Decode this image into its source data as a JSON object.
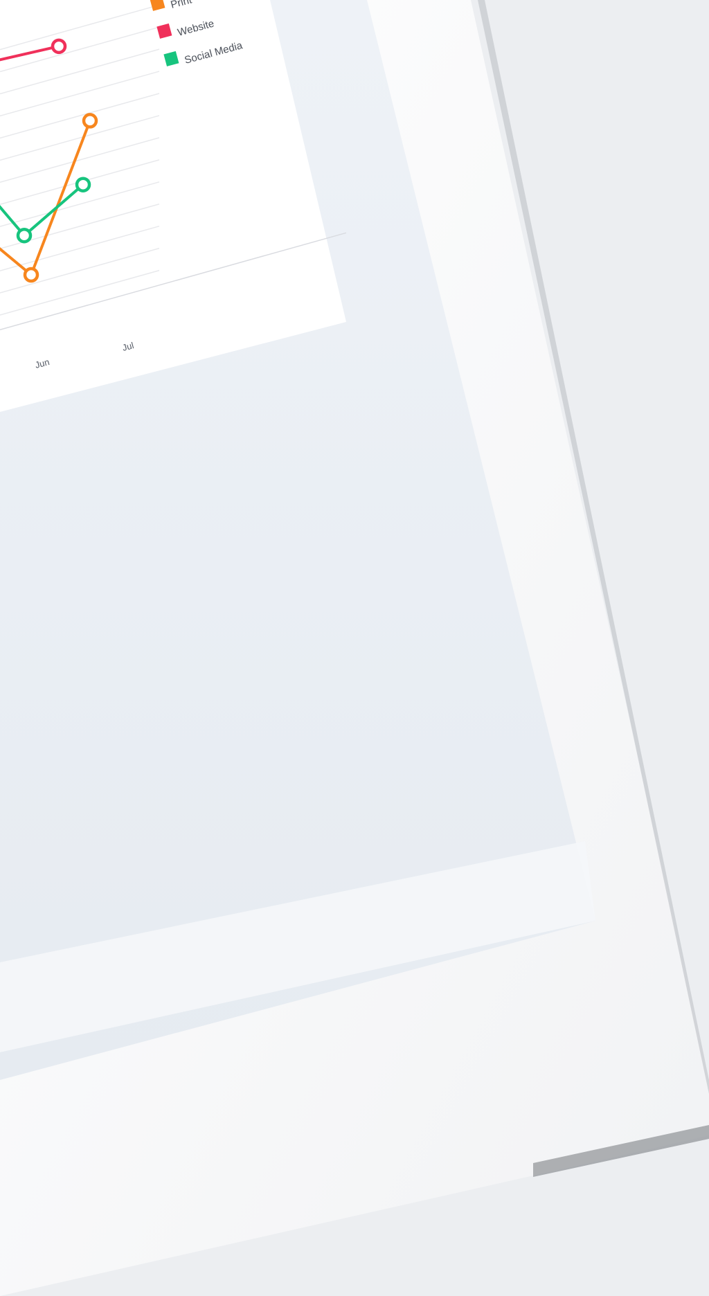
{
  "colors": {
    "print": "#f7861e",
    "website": "#f0305a",
    "social_media": "#17c47e",
    "screen_bg": "#e9edf3",
    "panel_bg": "#ffffff",
    "device_frame": "#fafafa"
  },
  "chart_data": {
    "type": "line",
    "categories": [
      "Jun",
      "Jul"
    ],
    "x_tick_labels": [
      "Jun",
      "Jul"
    ],
    "legend": [
      {
        "label": "Print",
        "color": "#f7861e"
      },
      {
        "label": "Website",
        "color": "#f0305a"
      },
      {
        "label": "Social Media",
        "color": "#17c47e"
      }
    ],
    "legend_position": "right",
    "grid": true,
    "series": [
      {
        "name": "Print",
        "color": "#f7861e",
        "visible_points": [
          {
            "x": "Jun",
            "y": 12
          },
          {
            "x": "Jul",
            "y": 68
          }
        ]
      },
      {
        "name": "Website",
        "color": "#f0305a",
        "visible_points": [
          {
            "x": "Jun",
            "y": 105
          }
        ]
      },
      {
        "name": "Social Media",
        "color": "#17c47e",
        "visible_points": [
          {
            "x": "Jun",
            "y": 28
          },
          {
            "x": "Jul",
            "y": 42
          }
        ]
      }
    ],
    "ylim": [
      0,
      110
    ],
    "note_visible_only": "partial chart cropped at left edge"
  }
}
